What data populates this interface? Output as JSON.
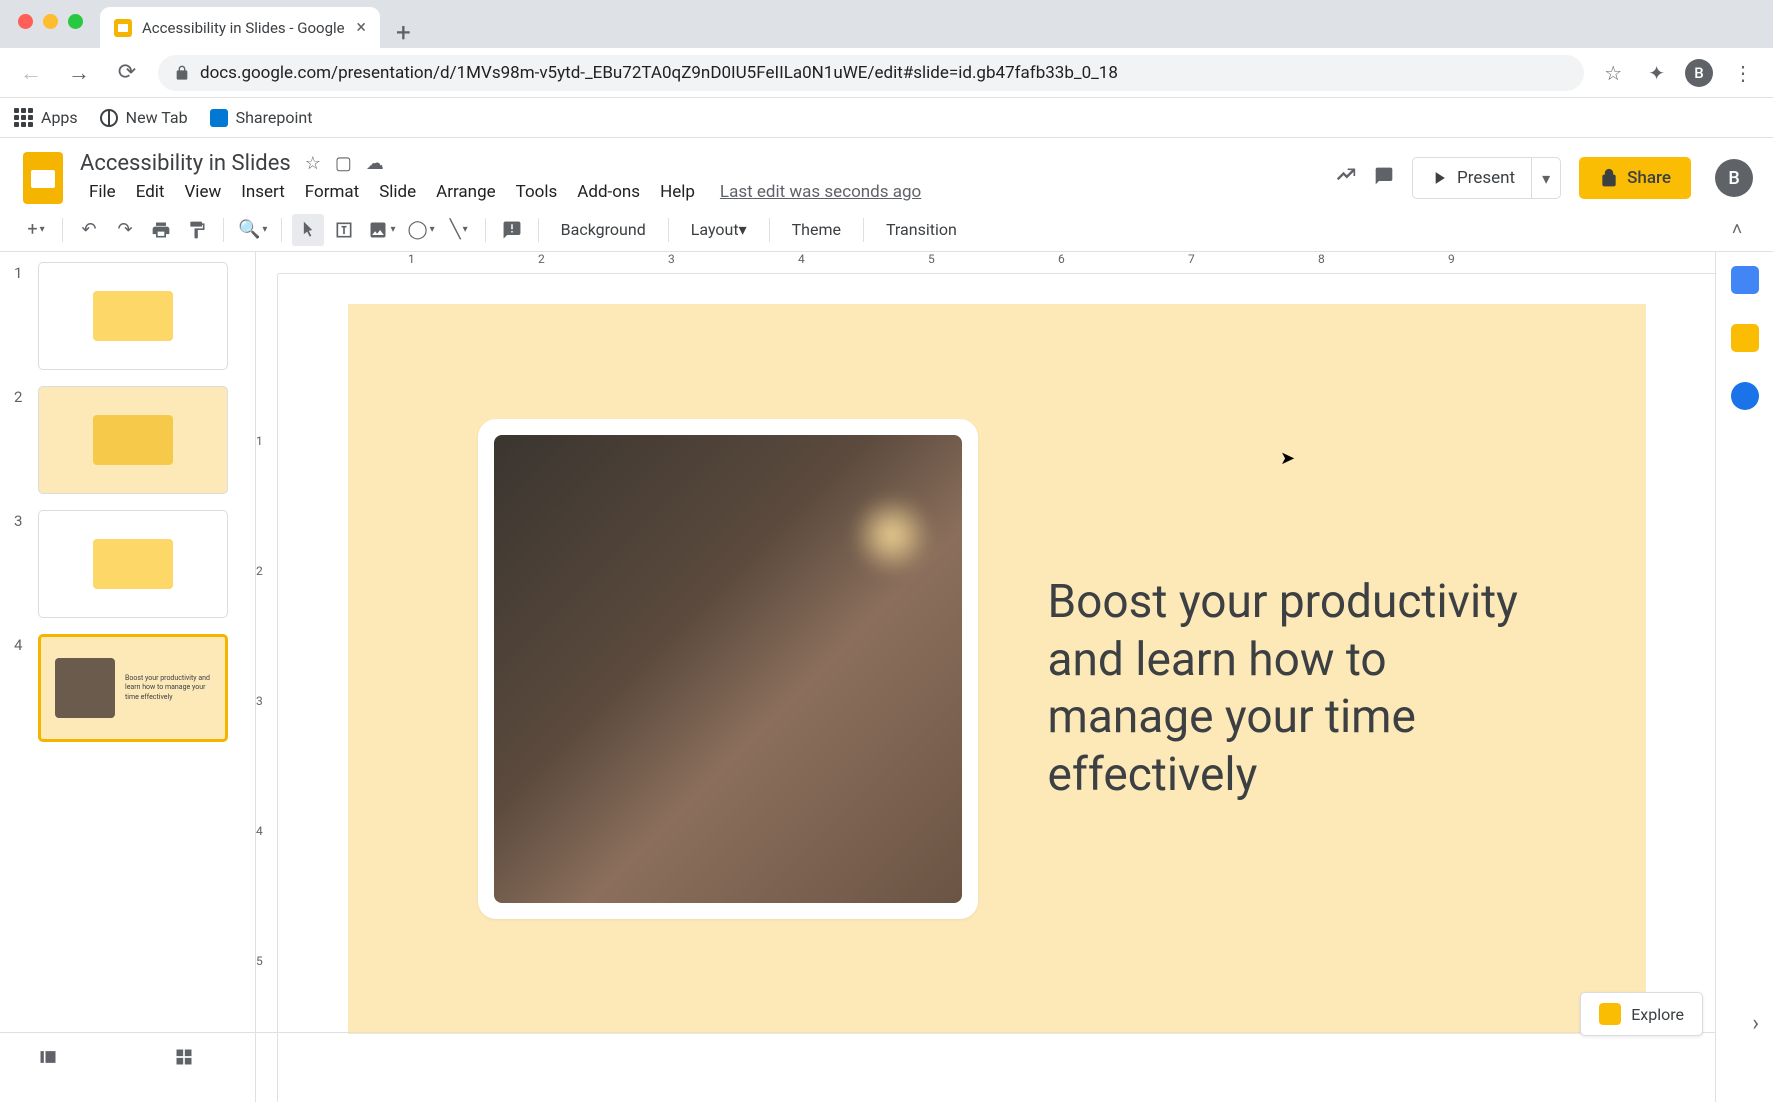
{
  "browser": {
    "tab_title": "Accessibility in Slides - Google",
    "url": "docs.google.com/presentation/d/1MVs98m-v5ytd-_EBu72TA0qZ9nD0IU5FeIILa0N1uWE/edit#slide=id.gb47fafb33b_0_18",
    "bookmarks": {
      "apps": "Apps",
      "new_tab": "New Tab",
      "sharepoint": "Sharepoint"
    },
    "avatar": "B"
  },
  "doc": {
    "title": "Accessibility in Slides",
    "last_edit": "Last edit was seconds ago"
  },
  "menus": [
    "File",
    "Edit",
    "View",
    "Insert",
    "Format",
    "Slide",
    "Arrange",
    "Tools",
    "Add-ons",
    "Help"
  ],
  "header": {
    "present": "Present",
    "share": "Share"
  },
  "toolbar": {
    "background": "Background",
    "layout": "Layout",
    "theme": "Theme",
    "transition": "Transition"
  },
  "slides": {
    "numbers": [
      "1",
      "2",
      "3",
      "4"
    ],
    "current": 4
  },
  "canvas": {
    "body_text": "Boost your productivity and learn how to manage your time effectively"
  },
  "ruler_h": [
    "1",
    "2",
    "3",
    "4",
    "5",
    "6",
    "7",
    "8",
    "9"
  ],
  "ruler_v": [
    "1",
    "2",
    "3",
    "4",
    "5"
  ],
  "explore": "Explore",
  "avatar": "B"
}
